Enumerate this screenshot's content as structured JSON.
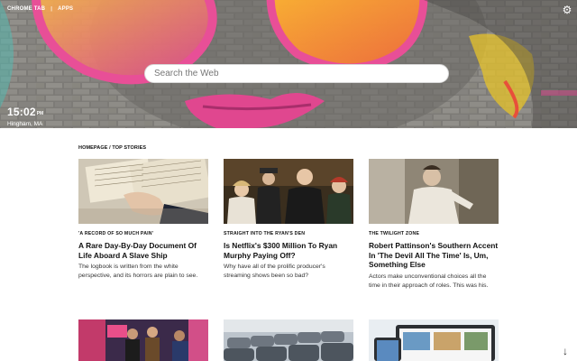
{
  "topnav": {
    "chrome_tab": "CHROME TAB",
    "separator": "|",
    "apps": "APPS"
  },
  "search": {
    "placeholder": "Search the Web"
  },
  "clock": {
    "time": "15:02",
    "ampm": "PM",
    "location": "Hingham, MA"
  },
  "icons": {
    "settings": "gear-icon",
    "scroll": "arrow-down-icon"
  },
  "section": {
    "label": "HOMEPAGE / TOP STORIES"
  },
  "stories": [
    {
      "kicker": "'A RECORD OF SO MUCH PAIN'",
      "headline": "A Rare Day-By-Day Document Of Life Aboard A Slave Ship",
      "summary": "The logbook is written from the white perspective, and its horrors are plain to see."
    },
    {
      "kicker": "STRAIGHT INTO THE RYAN'S DEN",
      "headline": "Is Netflix's $300 Million To Ryan Murphy Paying Off?",
      "summary": "Why have all of the prolific producer's streaming shows been so bad?"
    },
    {
      "kicker": "THE TWILIGHT ZONE",
      "headline": "Robert Pattinson's Southern Accent In 'The Devil All The Time' Is, Um, Something Else",
      "summary": "Actors make unconventional choices all the time in their approach of roles. This was his."
    }
  ],
  "colors": {
    "hero_wall": "#6c6a66",
    "graffiti_pink": "#e0478f",
    "graffiti_orange": "#f5a623",
    "graffiti_teal": "#56b9b0"
  }
}
